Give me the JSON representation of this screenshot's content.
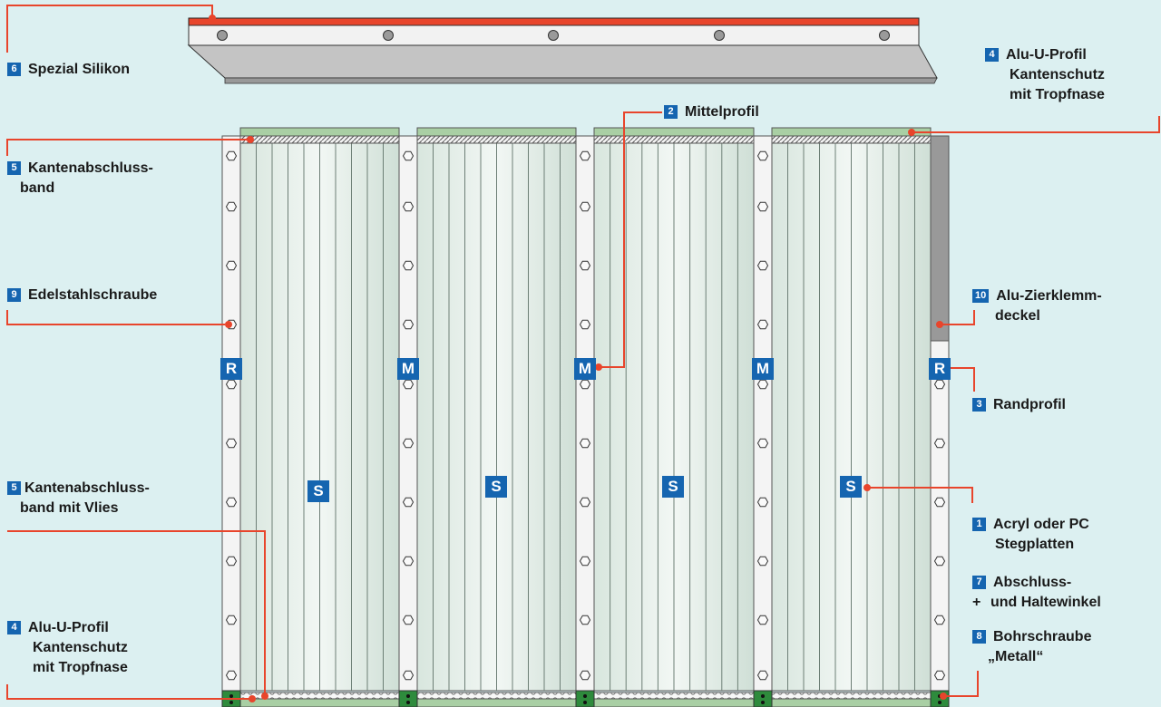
{
  "labels": {
    "spezial_silikon": {
      "num": "6",
      "line1": "Spezial Silikon"
    },
    "alu_u_profil_top": {
      "num": "4",
      "line1": "Alu-U-Profil",
      "line2": "Kantenschutz",
      "line3": "mit Tropfnase"
    },
    "mittelprofil": {
      "num": "2",
      "line1": "Mittelprofil"
    },
    "kantenabschluss": {
      "num": "5",
      "line1": "Kantenabschluss-",
      "line2": "band"
    },
    "edelstahlschraube": {
      "num": "9",
      "line1": "Edelstahlschraube"
    },
    "alu_zierklemm": {
      "num": "10",
      "line1": "Alu-Zierklemm-",
      "line2": "deckel"
    },
    "randprofil": {
      "num": "3",
      "line1": "Randprofil"
    },
    "kantenabschluss_vlies": {
      "num": "5",
      "line1": "Kantenabschluss-",
      "line2": "band mit Vlies"
    },
    "acryl": {
      "num": "1",
      "line1": "Acryl oder PC",
      "line2": "Stegplatten"
    },
    "abschluss": {
      "num": "7",
      "line1": "Abschluss-",
      "plus": "+",
      "line2": "und Haltewinkel"
    },
    "alu_u_profil_bottom": {
      "num": "4",
      "line1": "Alu-U-Profil",
      "line2": "Kantenschutz",
      "line3": "mit Tropfnase"
    },
    "bohrschraube": {
      "num": "8",
      "line1": "Bohrschraube",
      "line2": "„Metall“"
    }
  },
  "badges": {
    "randprofil_left": "R",
    "mittelprofil_1": "M",
    "mittelprofil_2": "M",
    "mittelprofil_3": "M",
    "randprofil_right": "R",
    "stegplatte_1": "S",
    "stegplatte_2": "S",
    "stegplatte_3": "S",
    "stegplatte_4": "S"
  },
  "colors": {
    "background": "#dcf0f1",
    "badge_blue": "#1565b0",
    "leader_red": "#e8452c",
    "profile_white": "#f4f4f4",
    "panel_green": "#a9cfa4",
    "edge_grey": "#999999"
  }
}
